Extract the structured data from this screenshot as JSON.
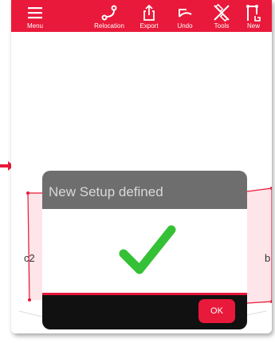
{
  "toolbar": {
    "items": [
      {
        "label": "Menu",
        "icon": "hamburger-icon"
      },
      {
        "label": "Relocation",
        "icon": "relocation-icon"
      },
      {
        "label": "Export",
        "icon": "export-icon"
      },
      {
        "label": "Undo",
        "icon": "undo-icon"
      },
      {
        "label": "Tools",
        "icon": "tools-icon"
      },
      {
        "label": "New",
        "icon": "new-sketch-icon"
      }
    ]
  },
  "canvas": {
    "left_label": "c2",
    "right_label": "b"
  },
  "dialog": {
    "title": "New Setup defined",
    "ok_label": "OK",
    "icon": "checkmark-icon"
  },
  "colors": {
    "accent": "#e8193a",
    "dialog_header": "#6e6e6e",
    "dialog_footer": "#111111",
    "check": "#35c135"
  }
}
